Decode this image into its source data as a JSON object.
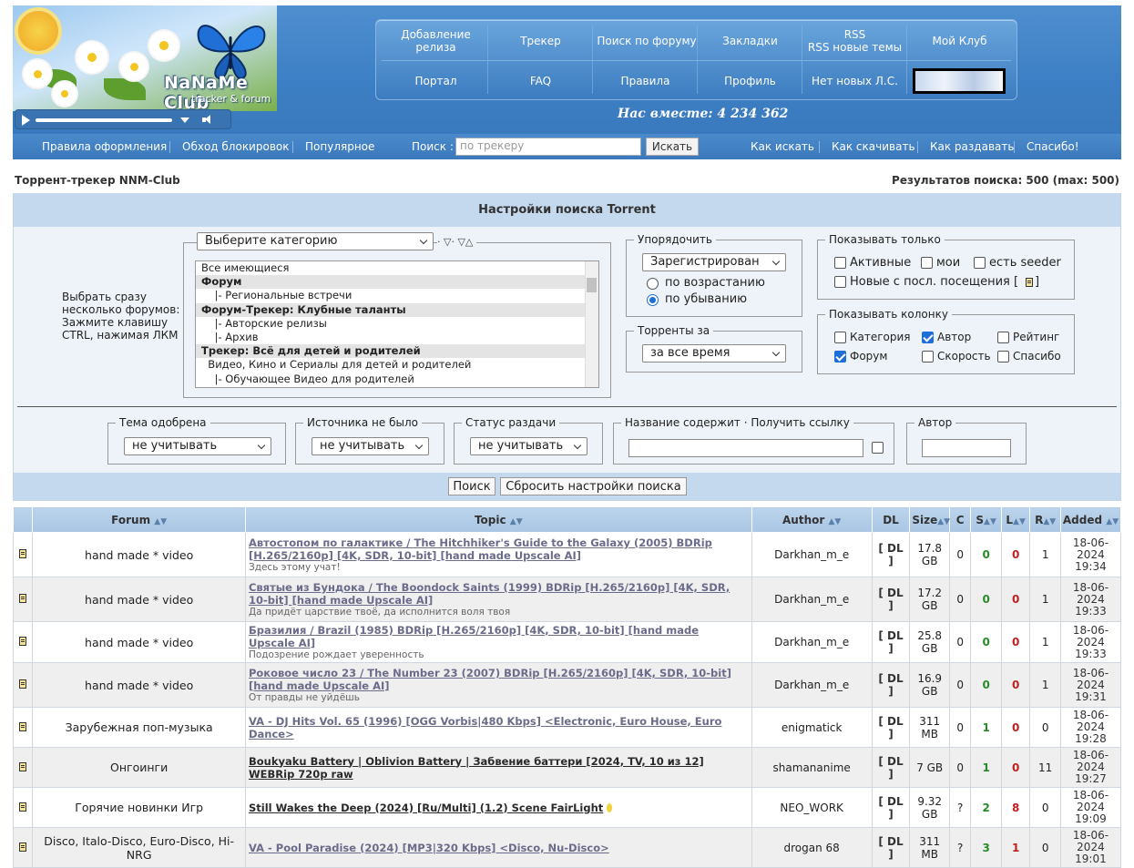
{
  "logo": {
    "title": "NaNaMe Club",
    "subtitle": "tracker & forum"
  },
  "topnav": {
    "row1": [
      "Добавление релиза",
      "Трекер",
      "Поиск по форуму",
      "Закладки",
      "RSS\nRSS новые темы",
      "Мой Клуб"
    ],
    "row2": [
      "Портал",
      "FAQ",
      "Правила",
      "Профиль",
      "Нет новых Л.С."
    ]
  },
  "together": "Нас вместе: 4 234 362",
  "subnav": {
    "left": [
      "Правила оформления",
      "Обход блокировок",
      "Популярное"
    ],
    "search_label": "Поиск :",
    "search_placeholder": "по трекеру",
    "search_button": "Искать",
    "right": [
      "Как искать",
      "Как скачивать",
      "Как раздавать",
      "Спасибо!"
    ]
  },
  "page": {
    "title": "Торрент-трекер NNM-Club",
    "results": "Результатов поиска: 500 (max: 500)"
  },
  "settings": {
    "title": "Настройки поиска Torrent",
    "hint": [
      "Выбрать сразу",
      "несколько форумов:",
      "Зажмите клавишу",
      "CTRL, нажимая ЛКМ"
    ],
    "category_select": "Выберите категорию",
    "category_icons": "· ▽· ▽△",
    "forum_list": [
      {
        "label": "Все имеющиеся",
        "group": false
      },
      {
        "label": "Форум",
        "group": true
      },
      {
        "label": "    |- Региональные встречи",
        "group": false
      },
      {
        "label": "Форум-Трекер: Клубные таланты",
        "group": true
      },
      {
        "label": "    |- Авторские релизы",
        "group": false
      },
      {
        "label": "    |- Архив",
        "group": false
      },
      {
        "label": "Трекер: Всё для детей и родителей",
        "group": true
      },
      {
        "label": "  Видео, Кино и Сериалы для детей и родителей",
        "group": false
      },
      {
        "label": "    |- Обучающее Видео для родителей",
        "group": false
      }
    ],
    "sort": {
      "legend": "Упорядочить",
      "value": "Зарегистрирован",
      "asc": "по возрастанию",
      "desc": "по убыванию",
      "selected": "desc"
    },
    "period": {
      "legend": "Торренты за",
      "value": "за все время"
    },
    "show_only": {
      "legend": "Показывать только",
      "items": [
        {
          "label": "Активные",
          "checked": false
        },
        {
          "label": "мои",
          "checked": false
        },
        {
          "label": "есть seeder",
          "checked": false
        },
        {
          "label": "Новые с посл. посещения [",
          "checked": false
        }
      ],
      "close": "]"
    },
    "columns": {
      "legend": "Показывать колонку",
      "items": [
        {
          "label": "Категория",
          "checked": false
        },
        {
          "label": "Автор",
          "checked": true
        },
        {
          "label": "Рейтинг",
          "checked": false
        },
        {
          "label": "Форум",
          "checked": true
        },
        {
          "label": "Скорость",
          "checked": false
        },
        {
          "label": "Спасибо",
          "checked": false
        }
      ]
    },
    "approved": {
      "legend": "Тема одобрена",
      "value": "не учитывать"
    },
    "no_source": {
      "legend": "Источника не было",
      "value": "не учитывать"
    },
    "status": {
      "legend": "Статус раздачи",
      "value": "не учитывать"
    },
    "name_contains": {
      "legend": "Название содержит",
      "link": " · Получить ссылку"
    },
    "author": {
      "legend": "Автор"
    },
    "search_button": "Поиск",
    "reset_button": "Сбросить настройки поиска"
  },
  "table": {
    "headers": [
      "Forum",
      "Topic",
      "Author",
      "DL",
      "Size",
      "C",
      "S",
      "L",
      "R",
      "Added"
    ],
    "sort_arrow": "▲▼",
    "rows": [
      {
        "forum": "hand made * video",
        "title": "Автостопом по галактике / The Hitchhiker's Guide to the Galaxy (2005) BDRip [H.265/2160p] [4K, SDR, 10-bit] [hand made Upscale AI]",
        "sub": "Здесь этому учат!",
        "author": "Darkhan_m_e",
        "dl": "[ DL ]",
        "size": "17.8 GB",
        "c": "0",
        "s": "0",
        "l": "0",
        "r": "1",
        "date": "18-06-2024",
        "time": "19:34",
        "dark": false
      },
      {
        "forum": "hand made * video",
        "title": "Святые из Бундока / The Boondock Saints (1999) BDRip [H.265/2160p] [4K, SDR, 10-bit] [hand made Upscale AI]",
        "sub": "Да придёт царствие твоё, да исполнится воля твоя",
        "author": "Darkhan_m_e",
        "dl": "[ DL ]",
        "size": "17.2 GB",
        "c": "0",
        "s": "0",
        "l": "0",
        "r": "1",
        "date": "18-06-2024",
        "time": "19:33",
        "dark": false
      },
      {
        "forum": "hand made * video",
        "title": "Бразилия / Brazil (1985) BDRip [H.265/2160p] [4K, SDR, 10-bit] [hand made Upscale AI]",
        "sub": "Подозрение рождает уверенность",
        "author": "Darkhan_m_e",
        "dl": "[ DL ]",
        "size": "25.8 GB",
        "c": "0",
        "s": "0",
        "l": "0",
        "r": "1",
        "date": "18-06-2024",
        "time": "19:33",
        "dark": false
      },
      {
        "forum": "hand made * video",
        "title": "Роковое число 23 / The Number 23 (2007) BDRip [H.265/2160p] [4K, SDR, 10-bit] [hand made Upscale AI]",
        "sub": "От правды не уйдёшь",
        "author": "Darkhan_m_e",
        "dl": "[ DL ]",
        "size": "16.9 GB",
        "c": "0",
        "s": "0",
        "l": "0",
        "r": "1",
        "date": "18-06-2024",
        "time": "19:31",
        "dark": false
      },
      {
        "forum": "Зарубежная поп-музыка",
        "title": "VA - DJ Hits Vol. 65 (1996) [OGG Vorbis|480 Kbps] <Electronic, Euro House, Euro Dance>",
        "sub": "",
        "author": "enigmatick",
        "dl": "[ DL ]",
        "size": "311 MB",
        "c": "0",
        "s": "1",
        "l": "0",
        "r": "0",
        "date": "18-06-2024",
        "time": "19:28",
        "dark": false
      },
      {
        "forum": "Онгоинги",
        "title": "Boukyaku Battery | Oblivion Battery | Забвение баттери [2024, TV, 10 из 12] WEBRip 720p raw",
        "sub": "",
        "author": "shamananime",
        "dl": "[ DL ]",
        "size": "7 GB",
        "c": "0",
        "s": "1",
        "l": "0",
        "r": "11",
        "date": "18-06-2024",
        "time": "19:27",
        "dark": true
      },
      {
        "forum": "Горячие новинки Игр",
        "title": "Still Wakes the Deep (2024) [Ru/Multi] (1.2) Scene FairLight",
        "sub": "",
        "author": "NEO_WORK",
        "dl": "[ DL ]",
        "size": "9.32 GB",
        "c": "?",
        "s": "2",
        "l": "8",
        "r": "0",
        "date": "18-06-2024",
        "time": "19:09",
        "dark": true,
        "gold": true
      },
      {
        "forum": "Disco, Italo-Disco, Euro-Disco, Hi-NRG",
        "title": "VA - Pool Paradise (2024) [MP3|320 Kbps] <Disco, Nu-Disco>",
        "sub": "",
        "author": "drogan 68",
        "dl": "[ DL ]",
        "size": "311 MB",
        "c": "?",
        "s": "3",
        "l": "1",
        "r": "0",
        "date": "18-06-2024",
        "time": "19:01",
        "dark": false
      }
    ]
  }
}
